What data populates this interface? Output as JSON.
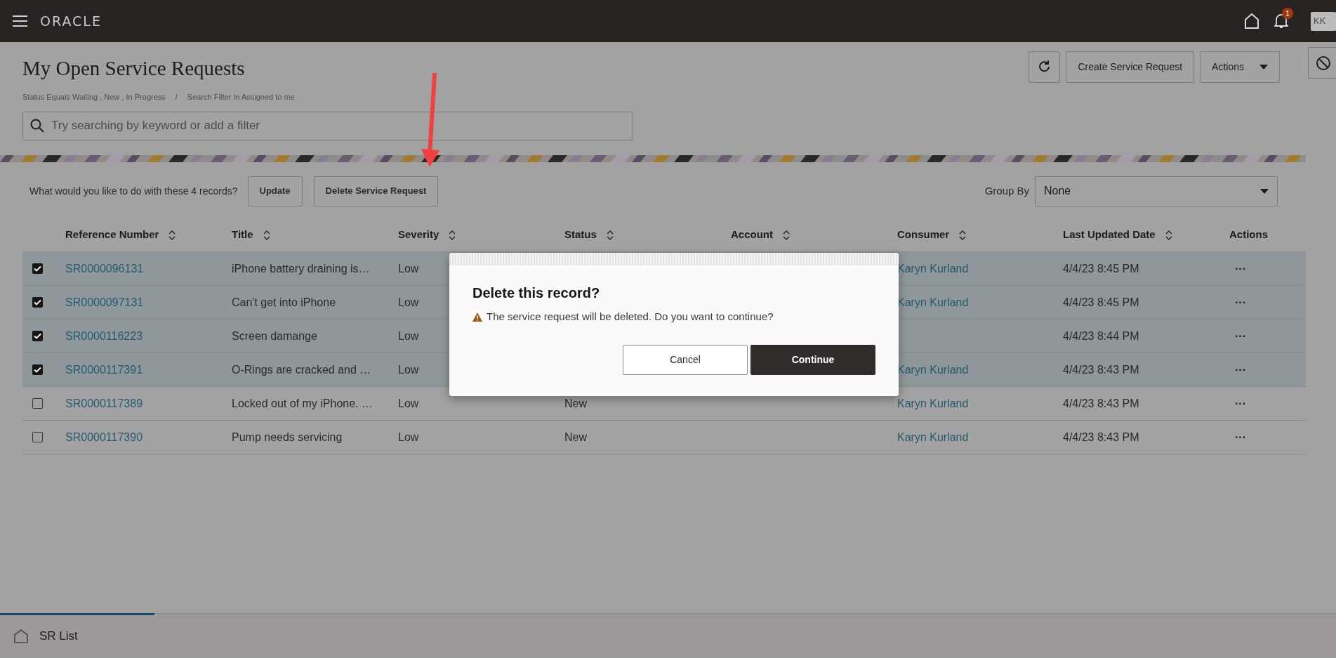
{
  "header": {
    "logo": "ORACLE",
    "notification_count": "1",
    "avatar": "KK"
  },
  "page": {
    "title": "My Open Service Requests",
    "filters": [
      "Status Equals Waiting , New , In Progress",
      "Search Filter In Assigned to me"
    ],
    "filter_separator": "/",
    "search": {
      "placeholder": "Try searching by keyword or add a filter"
    },
    "buttons": [
      {
        "label": "Create Service Request",
        "kind": "plain"
      },
      {
        "label": "Actions",
        "kind": "menu"
      }
    ]
  },
  "selection_bar": {
    "prompt": "What would you like to do with these 4 records?",
    "buttons": [
      "Update",
      "Delete Service Request"
    ]
  },
  "group_by": {
    "label": "Group By",
    "value": "None"
  },
  "table": {
    "columns": [
      {
        "label": "Reference Number",
        "sortable": true
      },
      {
        "label": "Title",
        "sortable": true
      },
      {
        "label": "Severity",
        "sortable": true
      },
      {
        "label": "Status",
        "sortable": true
      },
      {
        "label": "Account",
        "sortable": true
      },
      {
        "label": "Consumer",
        "sortable": true
      },
      {
        "label": "Last Updated Date",
        "sortable": true
      },
      {
        "label": "Actions",
        "sortable": false
      }
    ],
    "rows": [
      {
        "checked": true,
        "reference": "SR0000096131",
        "title": "iPhone battery draining is…",
        "severity": "Low",
        "consumer": "Karyn Kurland",
        "last_updated": "4/4/23 8:45 PM",
        "actions": "···"
      },
      {
        "checked": true,
        "reference": "SR0000097131",
        "title": "Can't get into iPhone",
        "severity": "Low",
        "consumer": "Karyn Kurland",
        "last_updated": "4/4/23 8:45 PM",
        "actions": "···"
      },
      {
        "checked": true,
        "reference": "SR0000116223",
        "title": "Screen damange",
        "severity": "Low",
        "last_updated": "4/4/23 8:44 PM",
        "actions": "···"
      },
      {
        "checked": true,
        "reference": "SR0000117391",
        "title": "O-Rings are cracked and …",
        "severity": "Low",
        "consumer": "Karyn Kurland",
        "last_updated": "4/4/23 8:43 PM",
        "actions": "···"
      },
      {
        "checked": false,
        "reference": "SR0000117389",
        "title": "Locked out of my iPhone. …",
        "severity": "Low",
        "status": "New",
        "consumer": "Karyn Kurland",
        "last_updated": "4/4/23 8:43 PM",
        "actions": "···"
      },
      {
        "checked": false,
        "reference": "SR0000117390",
        "title": "Pump needs servicing",
        "severity": "Low",
        "status": "New",
        "consumer": "Karyn Kurland",
        "last_updated": "4/4/23 8:43 PM",
        "actions": "···"
      }
    ]
  },
  "dialog": {
    "title": "Delete this record?",
    "message": "The service request will be deleted. Do you want to continue?",
    "buttons": [
      {
        "label": "Cancel",
        "kind": "secondary"
      },
      {
        "label": "Continue",
        "kind": "primary"
      }
    ]
  },
  "footer": {
    "tabs": [
      {
        "label": "SR List",
        "selected": true
      }
    ]
  }
}
